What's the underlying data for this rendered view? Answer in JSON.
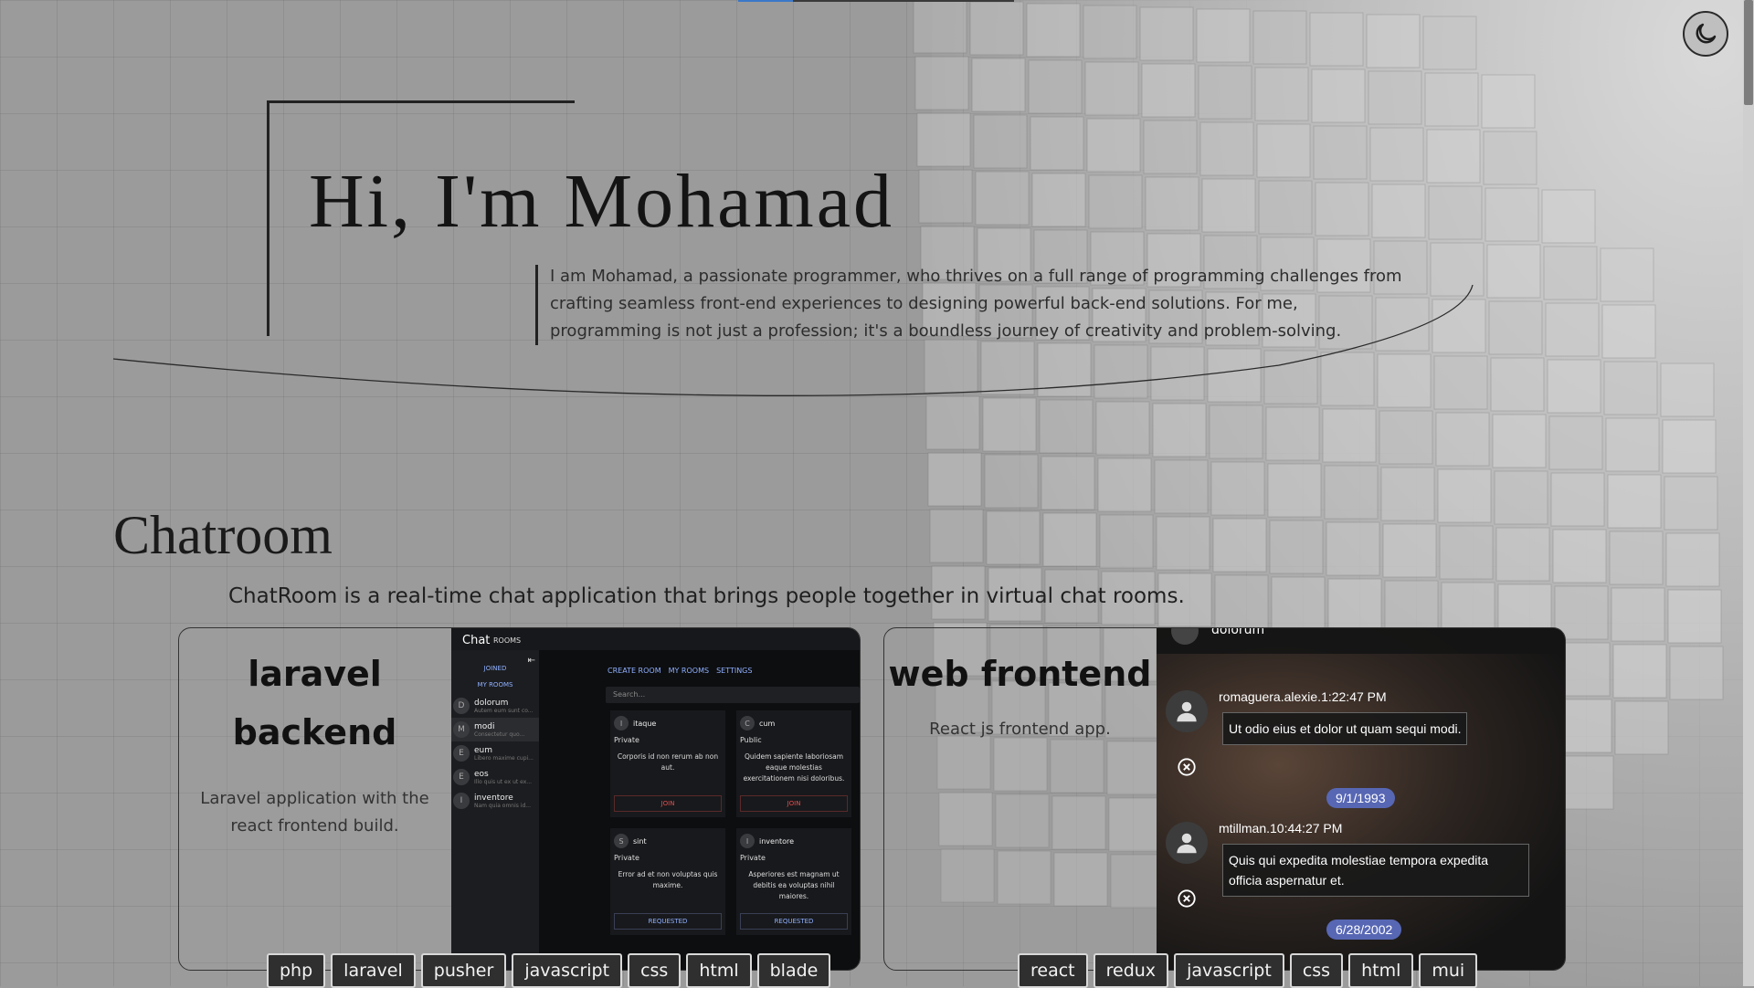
{
  "hero": {
    "title": "Hi, I'm Mohamad",
    "description": "I am Mohamad, a passionate programmer, who thrives on a full range of programming challenges from crafting seamless front-end experiences to designing powerful back-end solutions. For me, programming is not just a profession; it's a boundless journey of creativity and problem-solving."
  },
  "theme_toggle": {
    "icon": "moon-icon"
  },
  "project": {
    "title": "Chatroom",
    "description": "ChatRoom is a real-time chat application that brings people together in virtual chat rooms."
  },
  "cards": [
    {
      "title_line1": "laravel",
      "title_line2": "backend",
      "description": "Laravel application with the react frontend build.",
      "tags": [
        "php",
        "laravel",
        "pusher",
        "javascript",
        "css",
        "html",
        "blade"
      ]
    },
    {
      "title": "web frontend",
      "description": "React js frontend app.",
      "tags": [
        "react",
        "redux",
        "javascript",
        "css",
        "html",
        "mui"
      ]
    }
  ],
  "chat_app": {
    "brand": "Chat",
    "rooms_tab": "ROOMS",
    "joined_label": "JOINED",
    "my_rooms_label": "MY ROOMS",
    "rooms": [
      {
        "initial": "D",
        "name": "dolorum",
        "preview": "Autem eum sunt co..."
      },
      {
        "initial": "M",
        "name": "modi",
        "preview": "Consectetur quo..."
      },
      {
        "initial": "E",
        "name": "eum",
        "preview": "Libero maxime cupi..."
      },
      {
        "initial": "E",
        "name": "eos",
        "preview": "Illo quis ut ex ut ex..."
      },
      {
        "initial": "I",
        "name": "inventore",
        "preview": "Nam quia omnis id..."
      }
    ],
    "nav": [
      "CREATE ROOM",
      "MY ROOMS",
      "SETTINGS"
    ],
    "search_placeholder": "Search...",
    "room_cards": [
      {
        "initial": "I",
        "name": "itaque",
        "visibility": "Private",
        "body": "Corporis id non rerum ab non aut.",
        "action": "JOIN"
      },
      {
        "initial": "C",
        "name": "cum",
        "visibility": "Public",
        "body": "Quidem sapiente laboriosam eaque molestias exercitationem nisi doloribus.",
        "action": "JOIN"
      },
      {
        "initial": "S",
        "name": "sint",
        "visibility": "Private",
        "body": "Error ad et non voluptas quis maxime.",
        "action": "REQUESTED"
      },
      {
        "initial": "I",
        "name": "inventore",
        "visibility": "Private",
        "body": "Asperiores est magnam ut debitis ea voluptas nihil maiores.",
        "action": "REQUESTED"
      }
    ]
  },
  "web_app": {
    "header_name": "dolorum",
    "messages": [
      {
        "user": "romaguera.alexie.",
        "time": "1:22:47 PM",
        "text": "Ut odio eius et dolor ut quam sequi modi."
      },
      {
        "date": "9/1/1993"
      },
      {
        "user": "mtillman.",
        "time": "10:44:27 PM",
        "text": "Quis qui expedita molestiae tempora expedita officia aspernatur et."
      },
      {
        "date": "6/28/2002"
      }
    ]
  }
}
